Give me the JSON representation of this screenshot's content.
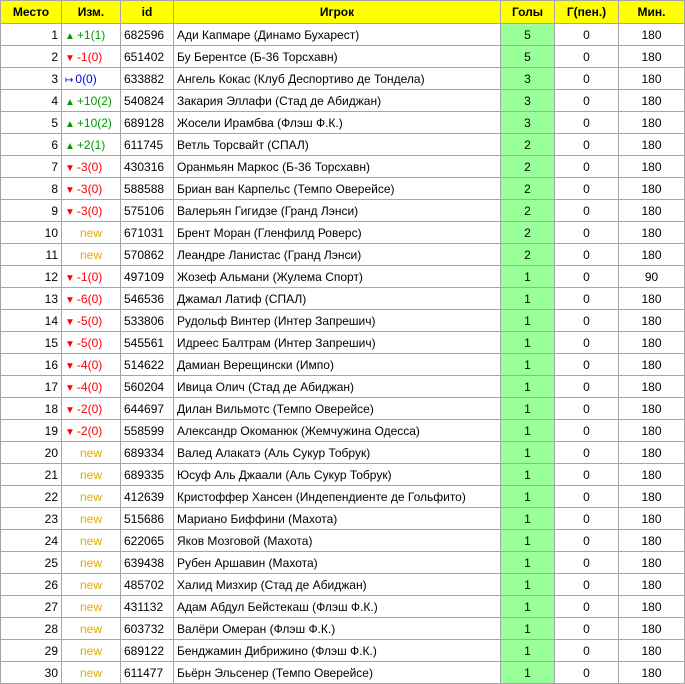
{
  "columns": {
    "rank": "Место",
    "change": "Изм.",
    "id": "id",
    "player": "Игрок",
    "goals": "Голы",
    "pen": "Г(пен.)",
    "min": "Мин."
  },
  "colors": {
    "header_bg": "#ffff00",
    "goals_bg": "#99ff99",
    "up": "#009900",
    "down": "#ff0000",
    "same": "#0000ff",
    "new": "#e6a700"
  },
  "rows": [
    {
      "rank": "1",
      "dir": "up",
      "change": "+1(1)",
      "id": "682596",
      "player": "Ади Капмаре (Динамо Бухарест)",
      "goals": "5",
      "pen": "0",
      "min": "180"
    },
    {
      "rank": "2",
      "dir": "down",
      "change": "-1(0)",
      "id": "651402",
      "player": "Бу Берентсе (Б-36 Торсхавн)",
      "goals": "5",
      "pen": "0",
      "min": "180"
    },
    {
      "rank": "3",
      "dir": "same",
      "change": "0(0)",
      "id": "633882",
      "player": "Ангель Кокас (Клуб Деспортиво де Тондела)",
      "goals": "3",
      "pen": "0",
      "min": "180"
    },
    {
      "rank": "4",
      "dir": "up",
      "change": "+10(2)",
      "id": "540824",
      "player": "Закария Эллафи (Стад де Абиджан)",
      "goals": "3",
      "pen": "0",
      "min": "180"
    },
    {
      "rank": "5",
      "dir": "up",
      "change": "+10(2)",
      "id": "689128",
      "player": "Жосели Ирамбва (Флэш Ф.К.)",
      "goals": "3",
      "pen": "0",
      "min": "180"
    },
    {
      "rank": "6",
      "dir": "up",
      "change": "+2(1)",
      "id": "611745",
      "player": "Ветль Торсвайт (СПАЛ)",
      "goals": "2",
      "pen": "0",
      "min": "180"
    },
    {
      "rank": "7",
      "dir": "down",
      "change": "-3(0)",
      "id": "430316",
      "player": "Оранмьян Маркос (Б-36 Торсхавн)",
      "goals": "2",
      "pen": "0",
      "min": "180"
    },
    {
      "rank": "8",
      "dir": "down",
      "change": "-3(0)",
      "id": "588588",
      "player": "Бриан ван Карпельс (Темпо Оверейсе)",
      "goals": "2",
      "pen": "0",
      "min": "180"
    },
    {
      "rank": "9",
      "dir": "down",
      "change": "-3(0)",
      "id": "575106",
      "player": "Валерьян Гигидзе (Гранд Лэнси)",
      "goals": "2",
      "pen": "0",
      "min": "180"
    },
    {
      "rank": "10",
      "dir": "new",
      "change": "new",
      "id": "671031",
      "player": "Брент Моран (Гленфилд Роверс)",
      "goals": "2",
      "pen": "0",
      "min": "180"
    },
    {
      "rank": "11",
      "dir": "new",
      "change": "new",
      "id": "570862",
      "player": "Леандре Ланистас (Гранд Лэнси)",
      "goals": "2",
      "pen": "0",
      "min": "180"
    },
    {
      "rank": "12",
      "dir": "down",
      "change": "-1(0)",
      "id": "497109",
      "player": "Жозеф Альмани (Жулема Спорт)",
      "goals": "1",
      "pen": "0",
      "min": "90"
    },
    {
      "rank": "13",
      "dir": "down",
      "change": "-6(0)",
      "id": "546536",
      "player": "Джамал Латиф (СПАЛ)",
      "goals": "1",
      "pen": "0",
      "min": "180"
    },
    {
      "rank": "14",
      "dir": "down",
      "change": "-5(0)",
      "id": "533806",
      "player": "Рудольф Винтер (Интер Запрешич)",
      "goals": "1",
      "pen": "0",
      "min": "180"
    },
    {
      "rank": "15",
      "dir": "down",
      "change": "-5(0)",
      "id": "545561",
      "player": "Идреес Балтрам (Интер Запрешич)",
      "goals": "1",
      "pen": "0",
      "min": "180"
    },
    {
      "rank": "16",
      "dir": "down",
      "change": "-4(0)",
      "id": "514622",
      "player": "Дамиан Верещински (Импо)",
      "goals": "1",
      "pen": "0",
      "min": "180"
    },
    {
      "rank": "17",
      "dir": "down",
      "change": "-4(0)",
      "id": "560204",
      "player": "Ивица Олич (Стад де Абиджан)",
      "goals": "1",
      "pen": "0",
      "min": "180"
    },
    {
      "rank": "18",
      "dir": "down",
      "change": "-2(0)",
      "id": "644697",
      "player": "Дилан Вильмотс (Темпо Оверейсе)",
      "goals": "1",
      "pen": "0",
      "min": "180"
    },
    {
      "rank": "19",
      "dir": "down",
      "change": "-2(0)",
      "id": "558599",
      "player": "Александр Окоманюк (Жемчужина Одесса)",
      "goals": "1",
      "pen": "0",
      "min": "180"
    },
    {
      "rank": "20",
      "dir": "new",
      "change": "new",
      "id": "689334",
      "player": "Валед Алакатэ (Аль Сукур Тобрук)",
      "goals": "1",
      "pen": "0",
      "min": "180"
    },
    {
      "rank": "21",
      "dir": "new",
      "change": "new",
      "id": "689335",
      "player": "Юсуф Аль Джаали (Аль Сукур Тобрук)",
      "goals": "1",
      "pen": "0",
      "min": "180"
    },
    {
      "rank": "22",
      "dir": "new",
      "change": "new",
      "id": "412639",
      "player": "Кристоффер Хансен (Индепендиенте де Гольфито)",
      "goals": "1",
      "pen": "0",
      "min": "180"
    },
    {
      "rank": "23",
      "dir": "new",
      "change": "new",
      "id": "515686",
      "player": "Мариано Биффини (Махота)",
      "goals": "1",
      "pen": "0",
      "min": "180"
    },
    {
      "rank": "24",
      "dir": "new",
      "change": "new",
      "id": "622065",
      "player": "Яков Мозговой (Махота)",
      "goals": "1",
      "pen": "0",
      "min": "180"
    },
    {
      "rank": "25",
      "dir": "new",
      "change": "new",
      "id": "639438",
      "player": "Рубен Аршавин (Махота)",
      "goals": "1",
      "pen": "0",
      "min": "180"
    },
    {
      "rank": "26",
      "dir": "new",
      "change": "new",
      "id": "485702",
      "player": "Халид Мизхир (Стад де Абиджан)",
      "goals": "1",
      "pen": "0",
      "min": "180"
    },
    {
      "rank": "27",
      "dir": "new",
      "change": "new",
      "id": "431132",
      "player": "Адам Абдул Бейстекаш (Флэш Ф.К.)",
      "goals": "1",
      "pen": "0",
      "min": "180"
    },
    {
      "rank": "28",
      "dir": "new",
      "change": "new",
      "id": "603732",
      "player": "Валёри Омеран (Флэш Ф.К.)",
      "goals": "1",
      "pen": "0",
      "min": "180"
    },
    {
      "rank": "29",
      "dir": "new",
      "change": "new",
      "id": "689122",
      "player": "Бенджамин Дибрижино (Флэш Ф.К.)",
      "goals": "1",
      "pen": "0",
      "min": "180"
    },
    {
      "rank": "30",
      "dir": "new",
      "change": "new",
      "id": "611477",
      "player": "Бьёрн Эльсенер (Темпо Оверейсе)",
      "goals": "1",
      "pen": "0",
      "min": "180"
    }
  ]
}
